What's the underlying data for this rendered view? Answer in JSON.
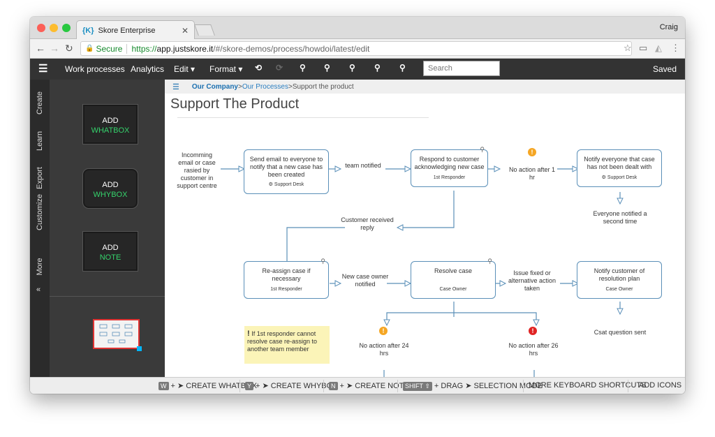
{
  "browser": {
    "tab_title": "Skore Enterprise",
    "tab_icon": "{K}",
    "user": "Craig",
    "secure_label": "Secure",
    "url_scheme": "https://",
    "url_host": "app.justskore.it",
    "url_path": "/#/skore-demos/process/howdoi/latest/edit"
  },
  "toolbar": {
    "work_processes": "Work processes",
    "analytics": "Analytics",
    "edit": "Edit ▾",
    "format": "Format ▾",
    "search_placeholder": "Search",
    "saved": "Saved"
  },
  "side_tabs": [
    "Create",
    "Learn",
    "Export",
    "Customize",
    "More"
  ],
  "side_collapse": "«",
  "palette": {
    "whatbox": {
      "add": "ADD",
      "label": "WHATBOX"
    },
    "whybox": {
      "add": "ADD",
      "label": "WHYBOX"
    },
    "note": {
      "add": "ADD",
      "label": "NOTE"
    }
  },
  "breadcrumb": {
    "company": "Our Company",
    "sep": " > ",
    "processes": "Our Processes",
    "current": "Support the product"
  },
  "process_title": "Support The Product",
  "diagram": {
    "start_text": "Incomming email or case rasied by customer in support centre",
    "box1": {
      "text": "Send email to everyone to notify that a new case has been created",
      "owner": "⚙ Support Desk"
    },
    "why1": "team notified",
    "box2": {
      "text": "Respond to customer acknowledging new case",
      "owner": "1st Responder"
    },
    "why2": "No action after 1 hr",
    "box3": {
      "text": "Notify everyone that case has not been dealt with",
      "owner": "⚙ Support Desk"
    },
    "why3": "Everyone notified a second time",
    "why_reply": "Customer received reply",
    "box4": {
      "text": "Re-assign case if necessary",
      "owner": "1st Responder"
    },
    "why4": "New case owner notified",
    "box5": {
      "text": "Resolve case",
      "owner": "Case Owner"
    },
    "why5": "Issue fixed or alternative action taken",
    "box6": {
      "text": "Notify customer of resolution plan",
      "owner": "Case Owner"
    },
    "why6": "Csat question sent",
    "note_text": "If 1st responder cannot resolve case re-assign to another team member",
    "why7": "No action after 24 hrs",
    "why8": "No action after 26 hrs",
    "warn_orange": "#f5a623",
    "warn_red": "#e02424"
  },
  "shortcuts": {
    "whatbox_key": "W",
    "whatbox": "CREATE WHATBOX",
    "whybox_key": "Y",
    "whybox": "CREATE WHYBOX",
    "note_key": "N",
    "note": "CREATE NOTE",
    "shift_key": "SHIFT ⇧",
    "drag": "+ DRAG",
    "selection": "SELECTION MODE",
    "more": "MORE KEYBOARD SHORTCUTS",
    "add_icons": "ADD ICONS"
  },
  "colors": {
    "accent": "#1a6fb0",
    "toolbar_bg": "#333333",
    "node_border": "#5a8fb8",
    "green": "#35d36c"
  }
}
